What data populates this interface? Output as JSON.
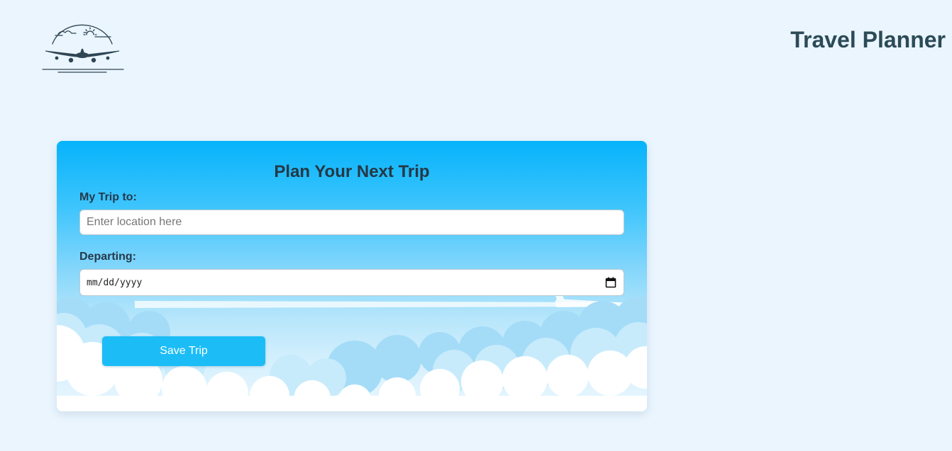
{
  "header": {
    "title": "Travel Planner"
  },
  "form": {
    "title": "Plan Your Next Trip",
    "trip_label": "My Trip to:",
    "location_placeholder": "Enter location here",
    "departing_label": "Departing:",
    "date_placeholder": "mm/dd/yyyy",
    "save_label": "Save Trip"
  },
  "icons": {
    "logo": "airplane-logo-icon",
    "date_picker": "calendar-icon"
  },
  "colors": {
    "page_background": "#eaf5fe",
    "title_text": "#2c4a57",
    "sky_top": "#06b3fb",
    "save_button": "#1cbdf7"
  }
}
